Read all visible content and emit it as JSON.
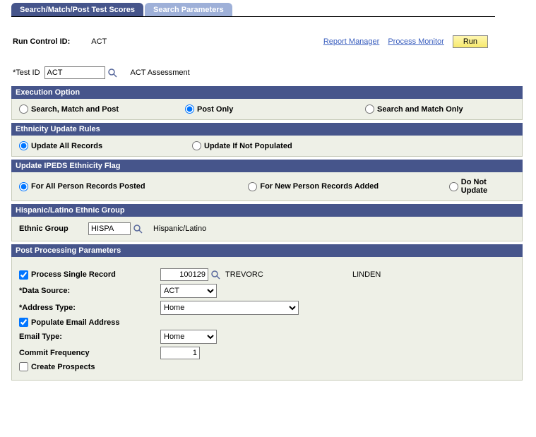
{
  "tabs": {
    "active": "Search/Match/Post Test Scores",
    "inactive": "Search Parameters"
  },
  "runControl": {
    "label": "Run Control ID:",
    "value": "ACT",
    "reportManager": "Report Manager",
    "processMonitor": "Process Monitor",
    "runBtn": "Run"
  },
  "test": {
    "label": "*Test ID",
    "value": "ACT",
    "desc": "ACT Assessment"
  },
  "execOpt": {
    "header": "Execution Option",
    "o1": "Search, Match and Post",
    "o2": "Post Only",
    "o3": "Search and Match Only"
  },
  "ethRules": {
    "header": "Ethnicity Update Rules",
    "o1": "Update All Records",
    "o2": "Update If Not Populated"
  },
  "ipeds": {
    "header": "Update IPEDS Ethnicity Flag",
    "o1": "For All Person Records Posted",
    "o2": "For New Person Records Added",
    "o3": "Do Not Update"
  },
  "hisp": {
    "header": "Hispanic/Latino Ethnic Group",
    "label": "Ethnic Group",
    "value": "HISPA",
    "desc": "Hispanic/Latino"
  },
  "post": {
    "header": "Post Processing Parameters",
    "single": "Process Single Record",
    "id": "100129",
    "name1": "TREVORC",
    "name2": "LINDEN",
    "dataSource": "*Data Source:",
    "dataSourceVal": "ACT",
    "addrType": "*Address Type:",
    "addrTypeVal": "Home",
    "popEmail": "Populate Email Address",
    "emailType": "Email Type:",
    "emailTypeVal": "Home",
    "commitFreq": "Commit Frequency",
    "commitFreqVal": "1",
    "createProspects": "Create Prospects"
  }
}
